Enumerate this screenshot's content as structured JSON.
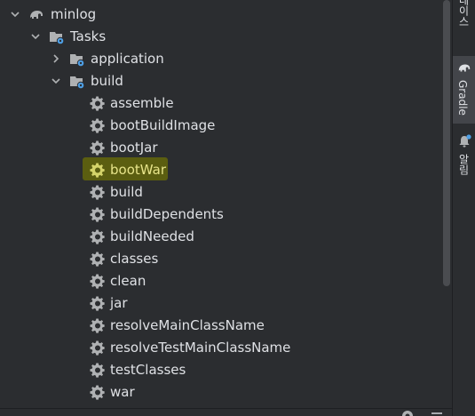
{
  "tree": {
    "root": {
      "label": "minlog",
      "icon": "elephant-icon",
      "expanded": true
    },
    "tasks": {
      "label": "Tasks",
      "icon": "folder-gear-icon",
      "expanded": true
    },
    "groups": [
      {
        "label": "application",
        "icon": "folder-gear-icon",
        "expanded": false
      },
      {
        "label": "build",
        "icon": "folder-gear-icon",
        "expanded": true
      }
    ],
    "build_tasks": [
      {
        "label": "assemble",
        "icon": "gear-icon"
      },
      {
        "label": "bootBuildImage",
        "icon": "gear-icon"
      },
      {
        "label": "bootJar",
        "icon": "gear-icon"
      },
      {
        "label": "bootWar",
        "icon": "gear-icon",
        "highlighted": true
      },
      {
        "label": "build",
        "icon": "gear-icon"
      },
      {
        "label": "buildDependents",
        "icon": "gear-icon"
      },
      {
        "label": "buildNeeded",
        "icon": "gear-icon"
      },
      {
        "label": "classes",
        "icon": "gear-icon"
      },
      {
        "label": "clean",
        "icon": "gear-icon"
      },
      {
        "label": "jar",
        "icon": "gear-icon"
      },
      {
        "label": "resolveMainClassName",
        "icon": "gear-icon"
      },
      {
        "label": "resolveTestMainClassName",
        "icon": "gear-icon"
      },
      {
        "label": "testClasses",
        "icon": "gear-icon"
      },
      {
        "label": "war",
        "icon": "gear-icon"
      }
    ]
  },
  "side_strip": {
    "top_label": "데이스",
    "gradle_label": "Gradle",
    "notifications_label": "알림"
  },
  "colors": {
    "background": "#2b2d30",
    "text": "#dfe1e5",
    "icon": "#afb1b3",
    "folder_badge": "#4e9fe5",
    "highlight_bg": "#5b5e10",
    "highlight_text": "#e7e48a",
    "notification_dot": "#4e9fe5"
  }
}
